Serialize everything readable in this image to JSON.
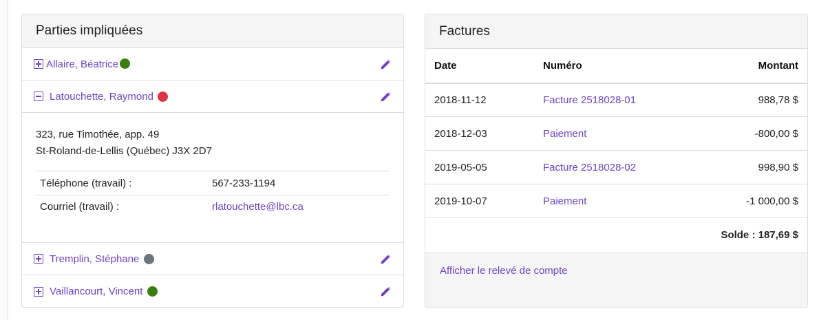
{
  "parties": {
    "title": "Parties impliquées",
    "items": [
      {
        "name": "Allaire, Béatrice",
        "status_color": "#3a7d10",
        "expanded": false
      },
      {
        "name": "Latouchette, Raymond",
        "status_color": "#dc3545",
        "expanded": true,
        "address_line1": "323, rue Timothée, app. 49",
        "address_line2": "St-Roland-de-Lellis (Québec) J3X 2D7",
        "contacts": [
          {
            "label": "Téléphone (travail)  :",
            "value": "567-233-1194"
          },
          {
            "label": "Courriel (travail) :",
            "value": "rlatouchette@lbc.ca"
          }
        ]
      },
      {
        "name": "Tremplin, Stéphane",
        "status_color": "#6c757d",
        "expanded": false
      },
      {
        "name": "Vaillancourt, Vincent",
        "status_color": "#3a7d10",
        "expanded": false
      }
    ]
  },
  "factures": {
    "title": "Factures",
    "columns": {
      "date": "Date",
      "numero": "Numéro",
      "montant": "Montant"
    },
    "rows": [
      {
        "date": "2018-11-12",
        "numero": "Facture 2518028-01",
        "montant": "988,78 $"
      },
      {
        "date": "2018-12-03",
        "numero": "Paiement",
        "montant": "-800,00 $"
      },
      {
        "date": "2019-05-05",
        "numero": "Facture 2518028-02",
        "montant": "998,90 $"
      },
      {
        "date": "2019-10-07",
        "numero": "Paiement",
        "montant": "-1 000,00 $"
      }
    ],
    "solde": "Solde : 187,69 $",
    "statement_link": "Afficher le relevé de compte"
  },
  "colors": {
    "accent": "#6f42c1",
    "header_bg": "#f5f5f5",
    "border": "#dcdcdc"
  }
}
